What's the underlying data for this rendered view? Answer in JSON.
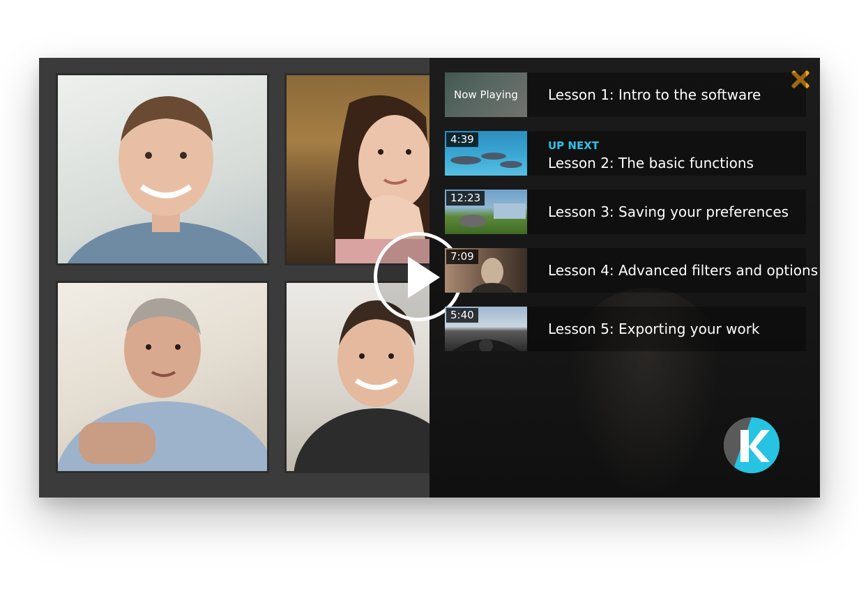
{
  "playlist": {
    "close_icon": "close-icon",
    "items": [
      {
        "label": "Lesson 1: Intro to the software",
        "thumb_text": "Now Playing"
      },
      {
        "label": "Lesson 2: The basic functions",
        "duration": "4:39",
        "badge": "UP NEXT"
      },
      {
        "label": "Lesson 3: Saving your preferences",
        "duration": "12:23"
      },
      {
        "label": "Lesson 4: Advanced filters and options",
        "duration": "7:09"
      },
      {
        "label": "Lesson 5: Exporting your work",
        "duration": "5:40"
      }
    ]
  },
  "player": {
    "play_icon": "play-icon"
  },
  "colors": {
    "accent_close": "#f5a01a",
    "up_next": "#2ac4e8",
    "logo_blue": "#26c3e2",
    "logo_gray": "#5a5a5a"
  }
}
